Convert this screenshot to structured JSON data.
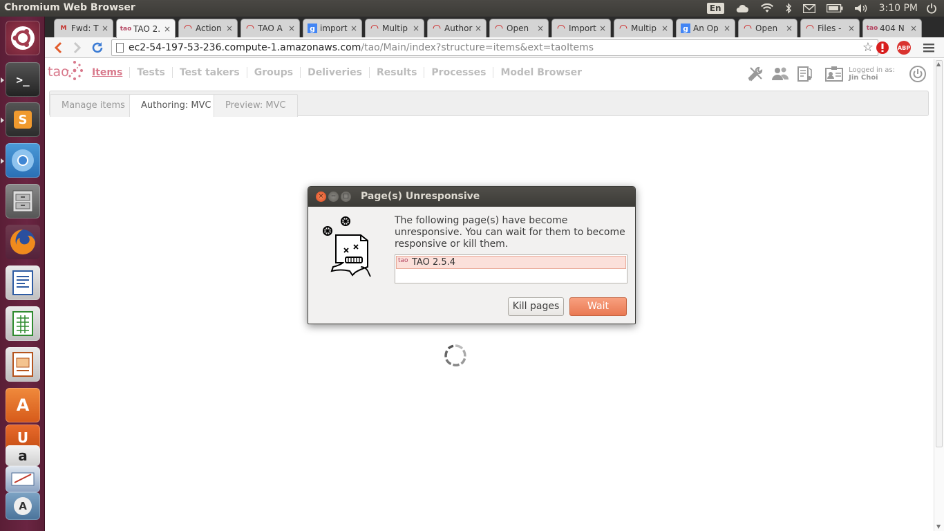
{
  "top_panel": {
    "app_title": "Chromium Web Browser",
    "keyboard_layout": "En",
    "clock": "3:10 PM",
    "icons": [
      "cloud-icon",
      "wifi-icon",
      "bluetooth-icon",
      "mail-icon",
      "battery-icon",
      "volume-icon",
      "power-icon"
    ]
  },
  "launcher": {
    "items": [
      "ubuntu-dash",
      "terminal",
      "sublime-text",
      "chromium",
      "file-manager",
      "firefox",
      "libreoffice-writer",
      "libreoffice-calc",
      "libreoffice-impress",
      "software-center",
      "ubuntu-one",
      "amazon",
      "workbench",
      "apt-manager"
    ],
    "sublime_letter": "S",
    "software_letter": "A",
    "ubuntu_one_letter": "U",
    "amazon_letter": "a",
    "workbench_letter": "A"
  },
  "tabs": [
    {
      "label": "Fwd: T",
      "icon": "gmail",
      "active": false
    },
    {
      "label": "TAO 2.",
      "icon": "tao",
      "active": true
    },
    {
      "label": "Action",
      "icon": "redhat",
      "active": false
    },
    {
      "label": "TAO A",
      "icon": "redhat",
      "active": false
    },
    {
      "label": "import",
      "icon": "google",
      "active": false
    },
    {
      "label": "Multip",
      "icon": "redhat",
      "active": false
    },
    {
      "label": "Author",
      "icon": "redhat",
      "active": false
    },
    {
      "label": "Open",
      "icon": "redhat",
      "active": false
    },
    {
      "label": "Import",
      "icon": "redhat",
      "active": false
    },
    {
      "label": "Multip",
      "icon": "redhat",
      "active": false
    },
    {
      "label": "An Op",
      "icon": "google",
      "active": false
    },
    {
      "label": "Open",
      "icon": "redhat",
      "active": false
    },
    {
      "label": "Files -",
      "icon": "redhat",
      "active": false
    },
    {
      "label": "404 N",
      "icon": "tao",
      "active": false
    }
  ],
  "tab_close_glyph": "×",
  "tao_favicon_text": "tao",
  "address_bar": {
    "host": "ec2-54-197-53-236.compute-1.amazonaws.com",
    "path": "/tao/Main/index?structure=items&ext=taoItems"
  },
  "extensions": {
    "adblock_label": "ABP"
  },
  "tao": {
    "logo": "tao",
    "nav": [
      "Items",
      "Tests",
      "Test takers",
      "Groups",
      "Deliveries",
      "Results",
      "Processes",
      "Model Browser"
    ],
    "active_nav": "Items",
    "logged_in_label": "Logged in as:",
    "user_name": "Jin Choi",
    "subtabs": [
      "Manage items",
      "Authoring: MVC",
      "Preview: MVC"
    ],
    "active_subtab": "Authoring: MVC"
  },
  "dialog": {
    "title": "Page(s) Unresponsive",
    "message": "The following page(s) have become unresponsive. You can wait for them to become responsive or kill them.",
    "pages": [
      "TAO 2.5.4"
    ],
    "kill_label": "Kill pages",
    "wait_label": "Wait",
    "close_glyph": "×",
    "minimize_glyph": "−",
    "maximize_glyph": "□"
  },
  "colors": {
    "launcher": "#6a2542",
    "tao_accent": "#d8788b",
    "wait_button": "#e97852",
    "panel": "#3c3b37"
  }
}
